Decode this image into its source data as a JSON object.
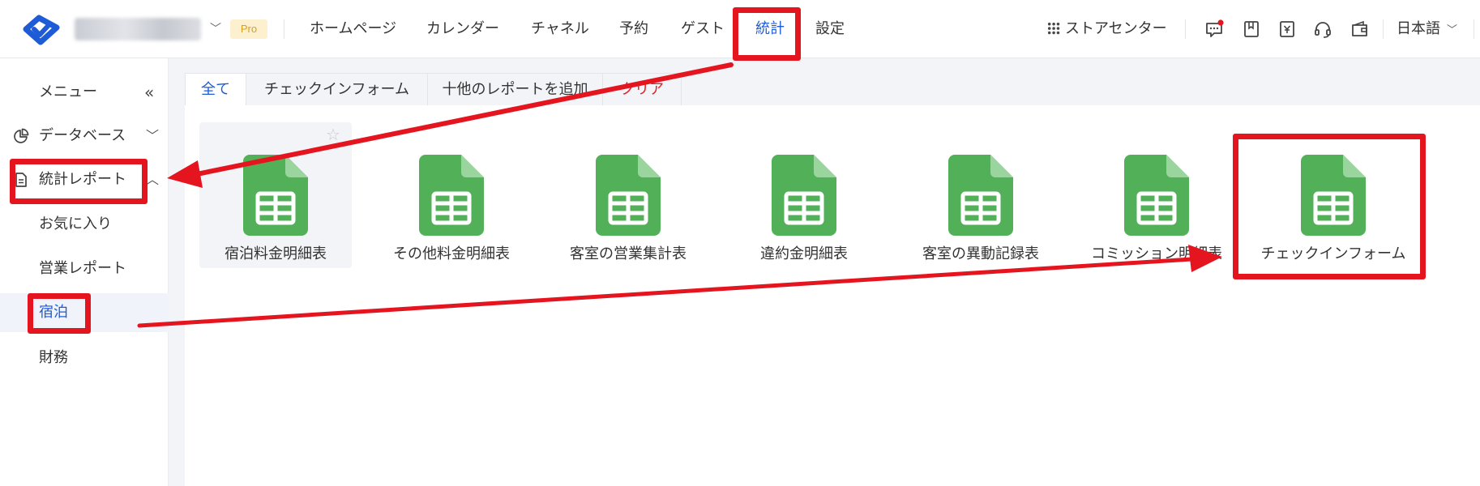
{
  "header": {
    "pro_badge": "Pro",
    "nav": [
      {
        "label": "ホームページ"
      },
      {
        "label": "カレンダー"
      },
      {
        "label": "チャネル"
      },
      {
        "label": "予約"
      },
      {
        "label": "ゲスト"
      },
      {
        "label": "統計",
        "active": true
      },
      {
        "label": "設定"
      }
    ],
    "store_center": "ストアセンター",
    "language": "日本語",
    "icons": [
      "messages-icon",
      "book-icon",
      "invoice-yen-icon",
      "headset-icon",
      "wallet-icon"
    ]
  },
  "sidebar": {
    "menu_label": "メニュー",
    "collapse_icon": "double-chevron-left-icon",
    "items": [
      {
        "label": "データベース",
        "icon": "pie-chart-icon",
        "chevron": "﹀"
      },
      {
        "label": "統計レポート",
        "icon": "document-icon",
        "chevron": "︿"
      },
      {
        "label": "お気に入り"
      },
      {
        "label": "営業レポート"
      },
      {
        "label": "宿泊",
        "selected": true
      },
      {
        "label": "財務"
      }
    ]
  },
  "tabs": [
    {
      "label": "全て",
      "active": true
    },
    {
      "label": "チェックインフォーム"
    },
    {
      "label": "十他のレポートを追加"
    },
    {
      "label": "クリア",
      "danger": true
    }
  ],
  "reports": [
    {
      "label": "宿泊料金明細表"
    },
    {
      "label": "その他料金明細表"
    },
    {
      "label": "客室の営業集計表"
    },
    {
      "label": "違約金明細表"
    },
    {
      "label": "客室の異動記録表"
    },
    {
      "label": "コミッション明細表"
    },
    {
      "label": "チェックインフォーム"
    }
  ],
  "colors": {
    "accent": "#1e5bd6",
    "sheet_green": "#52b058",
    "sheet_fold": "#9ad59d",
    "annotation_red": "#e5151f"
  }
}
